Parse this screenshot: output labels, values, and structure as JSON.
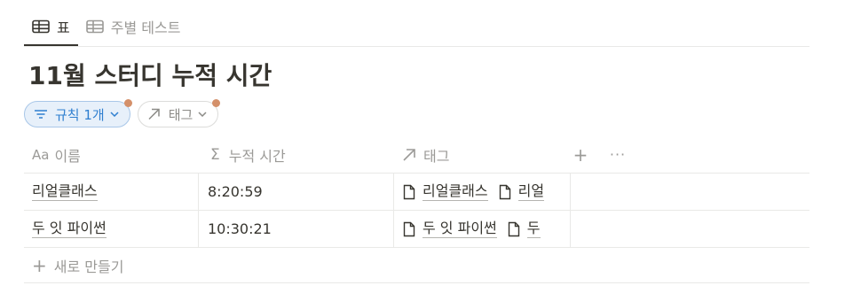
{
  "tabs": [
    {
      "label": "표",
      "icon": "table-icon",
      "active": true
    },
    {
      "label": "주별 테스트",
      "icon": "table-icon",
      "active": false
    }
  ],
  "page": {
    "title": "11월 스터디 누적 시간"
  },
  "filters": {
    "rule": {
      "label": "규칙 1개",
      "icon": "filter-lines-icon",
      "accent": "#2f7fd0"
    },
    "tag": {
      "label": "태그",
      "icon": "relation-arrow-icon"
    }
  },
  "table": {
    "columns": [
      {
        "prefix": "Aa",
        "label": "이름"
      },
      {
        "prefix": "Σ",
        "label": "누적 시간"
      },
      {
        "prefix": "↗",
        "label": "태그"
      }
    ],
    "actions": {
      "add": "+",
      "more": "···"
    },
    "rows": [
      {
        "name": "리얼클래스",
        "time": "8:20:59",
        "tags": [
          "리얼클래스",
          "리얼"
        ]
      },
      {
        "name": "두 잇 파이썬",
        "time": "10:30:21",
        "tags": [
          "두 잇 파이썬",
          "두"
        ]
      }
    ],
    "new_row": "새로 만들기"
  },
  "colors": {
    "text": "#37352f",
    "muted": "#9b9a97",
    "border": "#e9e9e7",
    "indicator": "#d4906a"
  }
}
